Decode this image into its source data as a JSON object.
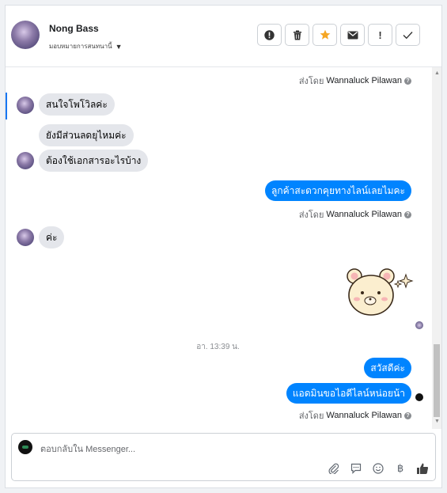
{
  "contact": {
    "name": "Nong Bass",
    "assign_label": "มอบหมายการสนทนานี้"
  },
  "actions": [
    {
      "icon": "alert-circle-icon",
      "label": "!"
    },
    {
      "icon": "trash-icon",
      "label": ""
    },
    {
      "icon": "star-icon",
      "label": ""
    },
    {
      "icon": "mail-icon",
      "label": ""
    },
    {
      "icon": "exclamation-icon",
      "label": "!"
    },
    {
      "icon": "check-icon",
      "label": ""
    }
  ],
  "sent_by_prefix": "ส่งโดย",
  "sender_name": "Wannaluck Pilawan",
  "messages": {
    "m1": "สนใจโพโวิลค่ะ",
    "m2": "ยังมีส่วนลดยุไหมค่ะ",
    "m3": "ต้องใช้เอกสารอะไรบ้าง",
    "m4": "ลูกค้าสะดวกคุยทางไลน์เลยไมคะ",
    "m5": "ค่ะ",
    "m6": "สวัสดีค่ะ",
    "m7": "แอดมินขอไอดีไลน์หน่อยน้า"
  },
  "timestamp": "อา. 13:39 น.",
  "composer": {
    "placeholder": "ตอบกลับใน Messenger..."
  },
  "colors": {
    "outgoing": "#0084ff",
    "incoming": "#e4e6eb",
    "star": "#f5a623"
  }
}
